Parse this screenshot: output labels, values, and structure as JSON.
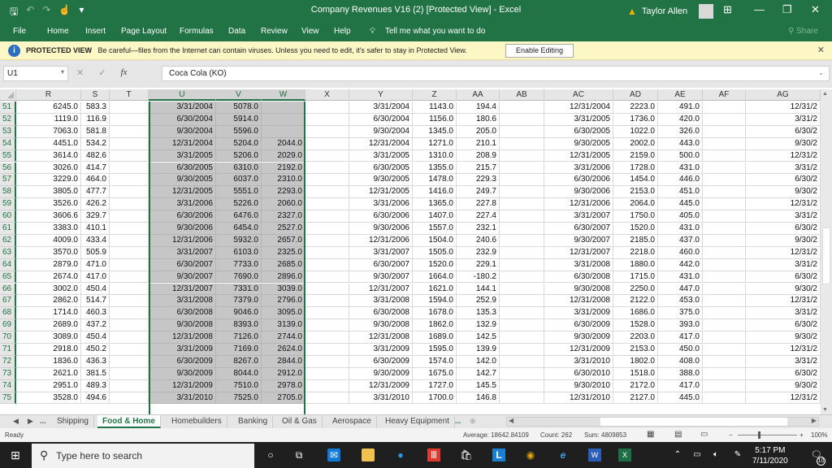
{
  "window": {
    "title": "Company Revenues V16 (2)  [Protected View]  -  Excel",
    "user": "Taylor Allen",
    "controls": {
      "ribbon_display": "⊞",
      "minimize": "—",
      "restore": "❐",
      "close": "✕"
    },
    "qat": {
      "save": "🖫",
      "undo": "↶",
      "redo": "↷",
      "touch": "☝",
      "customize": "▾"
    }
  },
  "menu": {
    "items": [
      "File",
      "Home",
      "Insert",
      "Page Layout",
      "Formulas",
      "Data",
      "Review",
      "View",
      "Help"
    ],
    "tell_me": "Tell me what you want to do",
    "share": "Share"
  },
  "protected_view": {
    "label": "PROTECTED VIEW",
    "message": "Be careful—files from the Internet can contain viruses. Unless you need to edit, it's safer to stay in Protected View.",
    "enable_button": "Enable Editing",
    "close": "✕"
  },
  "formula_bar": {
    "name_box": "U1",
    "cancel": "✕",
    "enter": "✓",
    "fx": "fx",
    "content": "Coca Cola (KO)"
  },
  "grid": {
    "columns": [
      "R",
      "S",
      "T",
      "U",
      "V",
      "W",
      "X",
      "Y",
      "Z",
      "AA",
      "AB",
      "AC",
      "AD",
      "AE",
      "AF",
      "AG"
    ],
    "selected_columns": [
      "U",
      "V",
      "W"
    ],
    "rows": [
      {
        "n": "51",
        "R": "6245.0",
        "S": "583.3",
        "U": "3/31/2004",
        "V": "5078.0",
        "W": "",
        "Y": "3/31/2004",
        "Z": "1143.0",
        "AA": "194.4",
        "AC": "12/31/2004",
        "AD": "2223.0",
        "AE": "491.0",
        "AG": "12/31/2"
      },
      {
        "n": "52",
        "R": "1119.0",
        "S": "116.9",
        "U": "6/30/2004",
        "V": "5914.0",
        "W": "",
        "Y": "6/30/2004",
        "Z": "1156.0",
        "AA": "180.6",
        "AC": "3/31/2005",
        "AD": "1736.0",
        "AE": "420.0",
        "AG": "3/31/2"
      },
      {
        "n": "53",
        "R": "7063.0",
        "S": "581.8",
        "U": "9/30/2004",
        "V": "5596.0",
        "W": "",
        "Y": "9/30/2004",
        "Z": "1345.0",
        "AA": "205.0",
        "AC": "6/30/2005",
        "AD": "1022.0",
        "AE": "326.0",
        "AG": "6/30/2"
      },
      {
        "n": "54",
        "R": "4451.0",
        "S": "534.2",
        "U": "12/31/2004",
        "V": "5204.0",
        "W": "2044.0",
        "Y": "12/31/2004",
        "Z": "1271.0",
        "AA": "210.1",
        "AC": "9/30/2005",
        "AD": "2002.0",
        "AE": "443.0",
        "AG": "9/30/2"
      },
      {
        "n": "55",
        "R": "3614.0",
        "S": "482.6",
        "U": "3/31/2005",
        "V": "5206.0",
        "W": "2029.0",
        "Y": "3/31/2005",
        "Z": "1310.0",
        "AA": "208.9",
        "AC": "12/31/2005",
        "AD": "2159.0",
        "AE": "500.0",
        "AG": "12/31/2"
      },
      {
        "n": "56",
        "R": "3026.0",
        "S": "414.7",
        "U": "6/30/2005",
        "V": "6310.0",
        "W": "2192.0",
        "Y": "6/30/2005",
        "Z": "1355.0",
        "AA": "215.7",
        "AC": "3/31/2006",
        "AD": "1728.0",
        "AE": "431.0",
        "AG": "3/31/2"
      },
      {
        "n": "57",
        "R": "3229.0",
        "S": "464.0",
        "U": "9/30/2005",
        "V": "6037.0",
        "W": "2310.0",
        "Y": "9/30/2005",
        "Z": "1478.0",
        "AA": "229.3",
        "AC": "6/30/2006",
        "AD": "1454.0",
        "AE": "446.0",
        "AG": "6/30/2"
      },
      {
        "n": "58",
        "R": "3805.0",
        "S": "477.7",
        "U": "12/31/2005",
        "V": "5551.0",
        "W": "2293.0",
        "Y": "12/31/2005",
        "Z": "1416.0",
        "AA": "249.7",
        "AC": "9/30/2006",
        "AD": "2153.0",
        "AE": "451.0",
        "AG": "9/30/2"
      },
      {
        "n": "59",
        "R": "3526.0",
        "S": "426.2",
        "U": "3/31/2006",
        "V": "5226.0",
        "W": "2060.0",
        "Y": "3/31/2006",
        "Z": "1365.0",
        "AA": "227.8",
        "AC": "12/31/2006",
        "AD": "2064.0",
        "AE": "445.0",
        "AG": "12/31/2"
      },
      {
        "n": "60",
        "R": "3606.6",
        "S": "329.7",
        "U": "6/30/2006",
        "V": "6476.0",
        "W": "2327.0",
        "Y": "6/30/2006",
        "Z": "1407.0",
        "AA": "227.4",
        "AC": "3/31/2007",
        "AD": "1750.0",
        "AE": "405.0",
        "AG": "3/31/2"
      },
      {
        "n": "61",
        "R": "3383.0",
        "S": "410.1",
        "U": "9/30/2006",
        "V": "6454.0",
        "W": "2527.0",
        "Y": "9/30/2006",
        "Z": "1557.0",
        "AA": "232.1",
        "AC": "6/30/2007",
        "AD": "1520.0",
        "AE": "431.0",
        "AG": "6/30/2"
      },
      {
        "n": "62",
        "R": "4009.0",
        "S": "433.4",
        "U": "12/31/2006",
        "V": "5932.0",
        "W": "2657.0",
        "Y": "12/31/2006",
        "Z": "1504.0",
        "AA": "240.6",
        "AC": "9/30/2007",
        "AD": "2185.0",
        "AE": "437.0",
        "AG": "9/30/2"
      },
      {
        "n": "63",
        "R": "3570.0",
        "S": "505.9",
        "U": "3/31/2007",
        "V": "6103.0",
        "W": "2325.0",
        "Y": "3/31/2007",
        "Z": "1505.0",
        "AA": "232.9",
        "AC": "12/31/2007",
        "AD": "2218.0",
        "AE": "460.0",
        "AG": "12/31/2"
      },
      {
        "n": "64",
        "R": "2879.0",
        "S": "471.0",
        "U": "6/30/2007",
        "V": "7733.0",
        "W": "2685.0",
        "Y": "6/30/2007",
        "Z": "1520.0",
        "AA": "229.1",
        "AC": "3/31/2008",
        "AD": "1880.0",
        "AE": "442.0",
        "AG": "3/31/2"
      },
      {
        "n": "65",
        "R": "2674.0",
        "S": "417.0",
        "U": "9/30/2007",
        "V": "7690.0",
        "W": "2896.0",
        "Y": "9/30/2007",
        "Z": "1664.0",
        "AA": "-180.2",
        "AC": "6/30/2008",
        "AD": "1715.0",
        "AE": "431.0",
        "AG": "6/30/2"
      },
      {
        "n": "66",
        "R": "3002.0",
        "S": "450.4",
        "U": "12/31/2007",
        "V": "7331.0",
        "W": "3039.0",
        "Y": "12/31/2007",
        "Z": "1621.0",
        "AA": "144.1",
        "AC": "9/30/2008",
        "AD": "2250.0",
        "AE": "447.0",
        "AG": "9/30/2"
      },
      {
        "n": "67",
        "R": "2862.0",
        "S": "514.7",
        "U": "3/31/2008",
        "V": "7379.0",
        "W": "2796.0",
        "Y": "3/31/2008",
        "Z": "1594.0",
        "AA": "252.9",
        "AC": "12/31/2008",
        "AD": "2122.0",
        "AE": "453.0",
        "AG": "12/31/2"
      },
      {
        "n": "68",
        "R": "1714.0",
        "S": "460.3",
        "U": "6/30/2008",
        "V": "9046.0",
        "W": "3095.0",
        "Y": "6/30/2008",
        "Z": "1678.0",
        "AA": "135.3",
        "AC": "3/31/2009",
        "AD": "1686.0",
        "AE": "375.0",
        "AG": "3/31/2"
      },
      {
        "n": "69",
        "R": "2689.0",
        "S": "437.2",
        "U": "9/30/2008",
        "V": "8393.0",
        "W": "3139.0",
        "Y": "9/30/2008",
        "Z": "1862.0",
        "AA": "132.9",
        "AC": "6/30/2009",
        "AD": "1528.0",
        "AE": "393.0",
        "AG": "6/30/2"
      },
      {
        "n": "70",
        "R": "3089.0",
        "S": "450.4",
        "U": "12/31/2008",
        "V": "7126.0",
        "W": "2744.0",
        "Y": "12/31/2008",
        "Z": "1689.0",
        "AA": "142.5",
        "AC": "9/30/2009",
        "AD": "2203.0",
        "AE": "417.0",
        "AG": "9/30/2"
      },
      {
        "n": "71",
        "R": "2918.0",
        "S": "450.2",
        "U": "3/31/2009",
        "V": "7169.0",
        "W": "2624.0",
        "Y": "3/31/2009",
        "Z": "1595.0",
        "AA": "139.9",
        "AC": "12/31/2009",
        "AD": "2153.0",
        "AE": "450.0",
        "AG": "12/31/2"
      },
      {
        "n": "72",
        "R": "1836.0",
        "S": "436.3",
        "U": "6/30/2009",
        "V": "8267.0",
        "W": "2844.0",
        "Y": "6/30/2009",
        "Z": "1574.0",
        "AA": "142.0",
        "AC": "3/31/2010",
        "AD": "1802.0",
        "AE": "408.0",
        "AG": "3/31/2"
      },
      {
        "n": "73",
        "R": "2621.0",
        "S": "381.5",
        "U": "9/30/2009",
        "V": "8044.0",
        "W": "2912.0",
        "Y": "9/30/2009",
        "Z": "1675.0",
        "AA": "142.7",
        "AC": "6/30/2010",
        "AD": "1518.0",
        "AE": "388.0",
        "AG": "6/30/2"
      },
      {
        "n": "74",
        "R": "2951.0",
        "S": "489.3",
        "U": "12/31/2009",
        "V": "7510.0",
        "W": "2978.0",
        "Y": "12/31/2009",
        "Z": "1727.0",
        "AA": "145.5",
        "AC": "9/30/2010",
        "AD": "2172.0",
        "AE": "417.0",
        "AG": "9/30/2"
      },
      {
        "n": "75",
        "R": "3528.0",
        "S": "494.6",
        "U": "3/31/2010",
        "V": "7525.0",
        "W": "2705.0",
        "Y": "3/31/2010",
        "Z": "1700.0",
        "AA": "146.8",
        "AC": "12/31/2010",
        "AD": "2127.0",
        "AE": "445.0",
        "AG": "12/31/2"
      }
    ]
  },
  "sheet_tabs": {
    "nav": {
      "prev": "◀",
      "next": "▶",
      "more_left": "...",
      "more_right": "...",
      "add": "⊕"
    },
    "tabs": [
      "Shipping",
      "Food & Home",
      "Homebuilders",
      "Banking",
      "Oil & Gas",
      "Aerospace",
      "Heavy Equipment"
    ],
    "active": "Food & Home"
  },
  "status_bar": {
    "ready": "Ready",
    "average": "Average: 18642.84109",
    "count": "Count: 262",
    "sum": "Sum: 4809853",
    "zoom_minus": "−",
    "zoom_plus": "+",
    "zoom": "100%"
  },
  "taskbar": {
    "search_placeholder": "Type here to search",
    "time": "5:17 PM",
    "date": "7/11/2020",
    "notifications": "10"
  },
  "colors": {
    "excel_green": "#217346",
    "protected_bar": "#fdf7c6",
    "selection": "#c6c6c6"
  }
}
